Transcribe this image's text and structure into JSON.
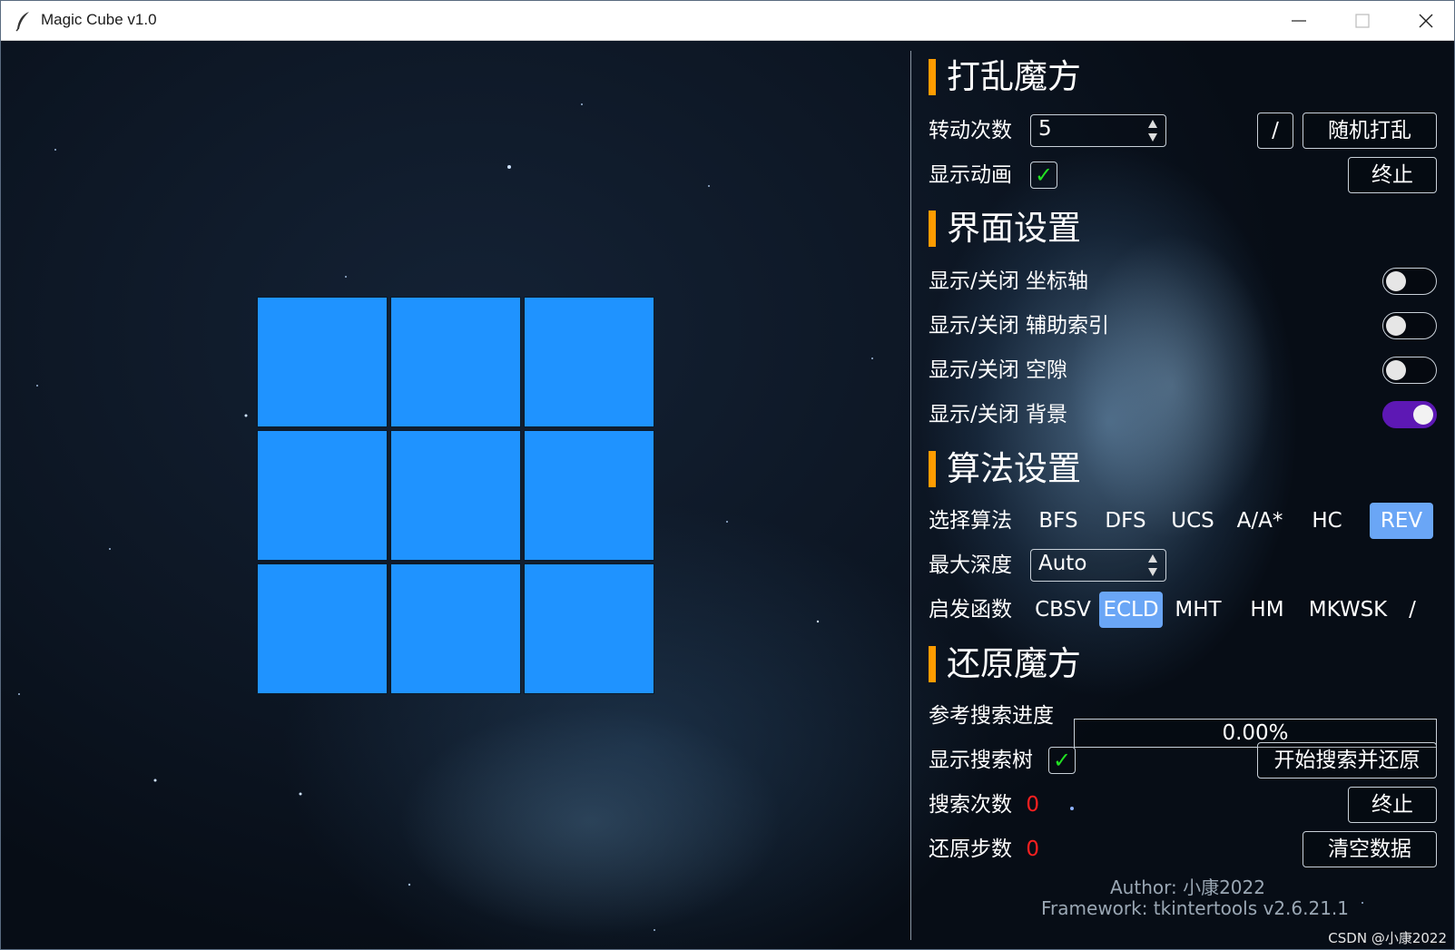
{
  "window": {
    "title": "Magic Cube v1.0",
    "controls": {
      "minimize": "minimize-icon",
      "maximize": "maximize-icon",
      "close": "close-icon"
    }
  },
  "cube": {
    "color": "#1f93ff",
    "rows": 3,
    "cols": 3
  },
  "scramble": {
    "title": "打乱魔方",
    "turns_label": "转动次数",
    "turns_value": "5",
    "slash_label": "/",
    "random_button": "随机打乱",
    "animation_label": "显示动画",
    "animation_checked": true,
    "stop_button": "终止"
  },
  "interface": {
    "title": "界面设置",
    "toggles": [
      {
        "label": "显示/关闭 坐标轴",
        "on": false
      },
      {
        "label": "显示/关闭 辅助索引",
        "on": false
      },
      {
        "label": "显示/关闭 空隙",
        "on": false
      },
      {
        "label": "显示/关闭 背景",
        "on": true
      }
    ]
  },
  "algorithm": {
    "title": "算法设置",
    "select_label": "选择算法",
    "algorithms": [
      "BFS",
      "DFS",
      "UCS",
      "A/A*",
      "HC",
      "REV"
    ],
    "selected_algorithm": "REV",
    "depth_label": "最大深度",
    "depth_value": "Auto",
    "heuristic_label": "启发函数",
    "heuristics": [
      "CBSV",
      "ECLD",
      "MHT",
      "HM",
      "MKWSK",
      "/"
    ],
    "selected_heuristic": "ECLD"
  },
  "solve": {
    "title": "还原魔方",
    "progress_label": "参考搜索进度",
    "progress_value": "0.00%",
    "progress_fraction": 0.0,
    "tree_label": "显示搜索树",
    "tree_checked": true,
    "start_button": "开始搜索并还原",
    "search_count_label": "搜索次数",
    "search_count": "0",
    "stop_button": "终止",
    "steps_label": "还原步数",
    "steps": "0",
    "clear_button": "清空数据"
  },
  "footer": {
    "author": "Author: 小康2022",
    "framework": "Framework: tkintertools v2.6.21.1",
    "watermark": "CSDN @小康2022"
  },
  "colors": {
    "accent": "#ff9c00",
    "selected": "#6aa6f6",
    "toggle_on": "#5d18b4",
    "check": "#22e022",
    "counter": "#ff2020"
  }
}
